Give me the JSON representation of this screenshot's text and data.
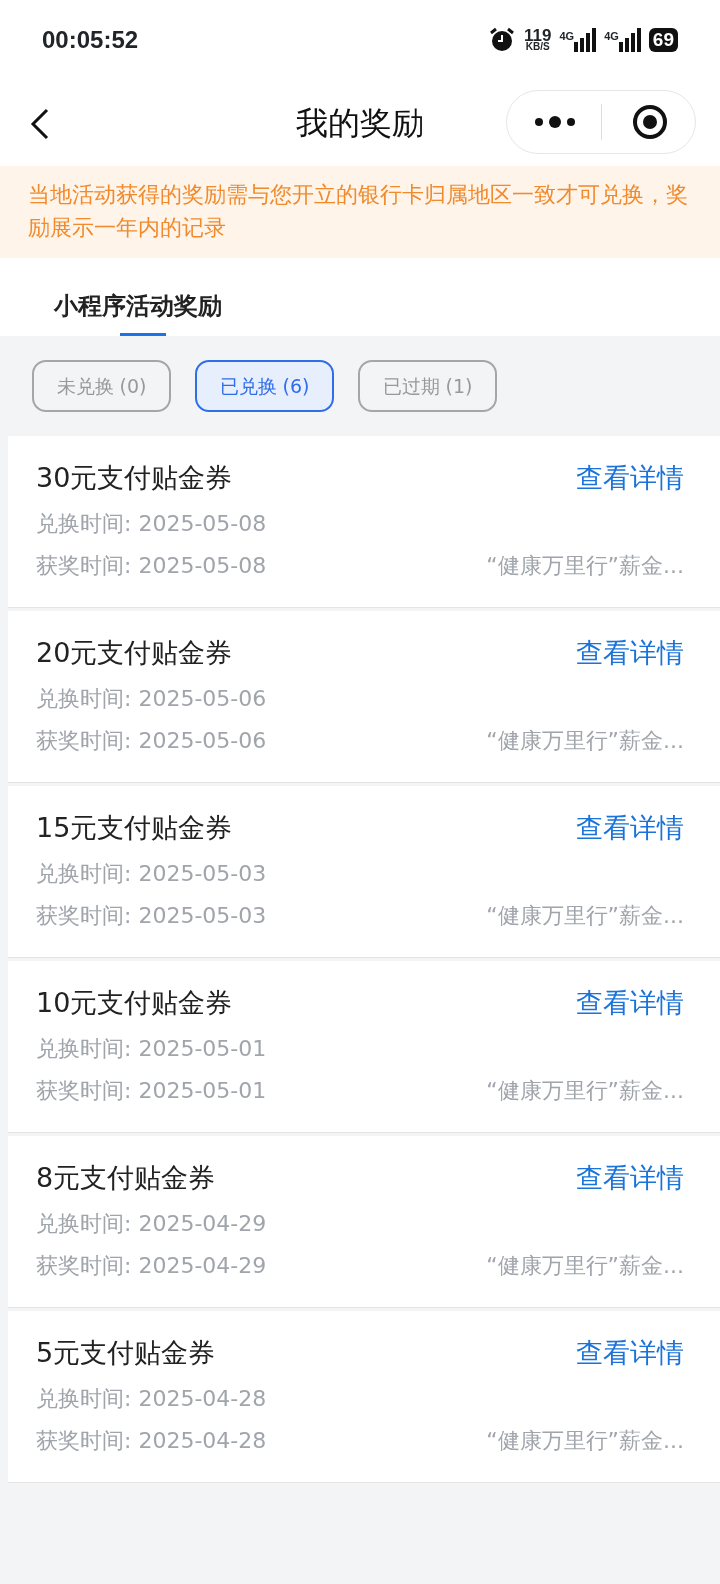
{
  "status_bar": {
    "time": "00:05:52",
    "speed": "119",
    "speed_unit": "KB/S",
    "networks": [
      "4G",
      "4G"
    ],
    "battery": "69"
  },
  "nav": {
    "title": "我的奖励"
  },
  "notice": "当地活动获得的奖励需与您开立的银行卡归属地区一致才可兑换，奖励展示一年内的记录",
  "tabs": [
    {
      "label": "小程序活动奖励",
      "selected": true
    }
  ],
  "filters": [
    {
      "label": "未兑换 (0)",
      "selected": false
    },
    {
      "label": "已兑换 (6)",
      "selected": true
    },
    {
      "label": "已过期 (1)",
      "selected": false
    }
  ],
  "rewards": [
    {
      "title": "30元支付贴金券",
      "action": "查看详情",
      "redeem_time": "兑换时间: 2025-05-08",
      "award_time": "获奖时间: 2025-05-08",
      "source": "“健康万里行”薪金..."
    },
    {
      "title": "20元支付贴金券",
      "action": "查看详情",
      "redeem_time": "兑换时间: 2025-05-06",
      "award_time": "获奖时间: 2025-05-06",
      "source": "“健康万里行”薪金..."
    },
    {
      "title": "15元支付贴金券",
      "action": "查看详情",
      "redeem_time": "兑换时间: 2025-05-03",
      "award_time": "获奖时间: 2025-05-03",
      "source": "“健康万里行”薪金..."
    },
    {
      "title": "10元支付贴金券",
      "action": "查看详情",
      "redeem_time": "兑换时间: 2025-05-01",
      "award_time": "获奖时间: 2025-05-01",
      "source": "“健康万里行”薪金..."
    },
    {
      "title": "8元支付贴金券",
      "action": "查看详情",
      "redeem_time": "兑换时间: 2025-04-29",
      "award_time": "获奖时间: 2025-04-29",
      "source": "“健康万里行”薪金..."
    },
    {
      "title": "5元支付贴金券",
      "action": "查看详情",
      "redeem_time": "兑换时间: 2025-04-28",
      "award_time": "获奖时间: 2025-04-28",
      "source": "“健康万里行”薪金..."
    }
  ]
}
